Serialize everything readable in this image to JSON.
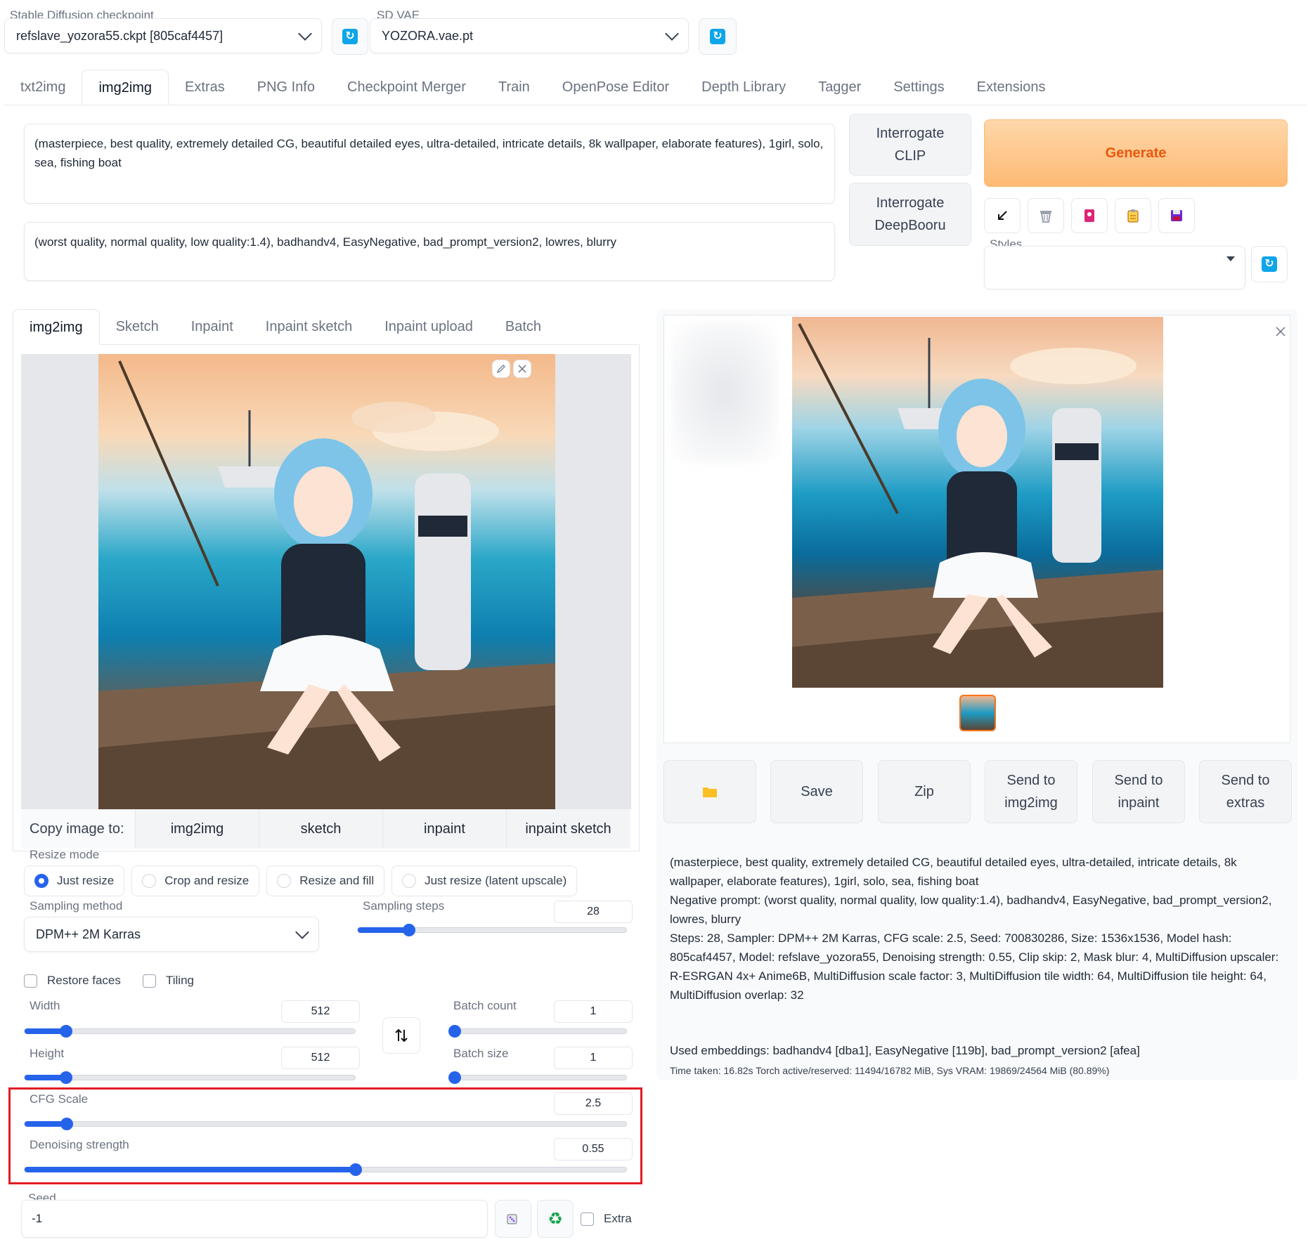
{
  "top": {
    "checkpoint_label": "Stable Diffusion checkpoint",
    "checkpoint_value": "refslave_yozora55.ckpt [805caf4457]",
    "vae_label": "SD VAE",
    "vae_value": "YOZORA.vae.pt"
  },
  "main_tabs": [
    "txt2img",
    "img2img",
    "Extras",
    "PNG Info",
    "Checkpoint Merger",
    "Train",
    "OpenPose Editor",
    "Depth Library",
    "Tagger",
    "Settings",
    "Extensions"
  ],
  "prompt": {
    "positive": "(masterpiece, best quality, extremely detailed CG, beautiful detailed eyes, ultra-detailed, intricate details, 8k wallpaper, elaborate features), 1girl, solo, sea, fishing boat",
    "negative": "(worst quality, normal quality, low quality:1.4), badhandv4, EasyNegative, bad_prompt_version2, lowres, blurry"
  },
  "interrogate": {
    "clip_line1": "Interrogate",
    "clip_line2": "CLIP",
    "deepbooru_line1": "Interrogate",
    "deepbooru_line2": "DeepBooru"
  },
  "generate_label": "Generate",
  "styles_label": "Styles",
  "sub_tabs": [
    "img2img",
    "Sketch",
    "Inpaint",
    "Inpaint sketch",
    "Inpaint upload",
    "Batch"
  ],
  "copy_image": {
    "label": "Copy image to:",
    "targets": [
      "img2img",
      "sketch",
      "inpaint",
      "inpaint sketch"
    ]
  },
  "resize_mode": {
    "label": "Resize mode",
    "options": [
      "Just resize",
      "Crop and resize",
      "Resize and fill",
      "Just resize (latent upscale)"
    ],
    "selected": "Just resize"
  },
  "sampling": {
    "method_label": "Sampling method",
    "method_value": "DPM++ 2M Karras",
    "steps_label": "Sampling steps",
    "steps_value": "28"
  },
  "checkboxes": {
    "restore_faces": "Restore faces",
    "tiling": "Tiling"
  },
  "dims": {
    "width_label": "Width",
    "width_value": "512",
    "height_label": "Height",
    "height_value": "512",
    "batch_count_label": "Batch count",
    "batch_count_value": "1",
    "batch_size_label": "Batch size",
    "batch_size_value": "1"
  },
  "cfg": {
    "label": "CFG Scale",
    "value": "2.5",
    "denoise_label": "Denoising strength",
    "denoise_value": "0.55"
  },
  "seed": {
    "label": "Seed",
    "value": "-1",
    "extra_label": "Extra"
  },
  "output_buttons": {
    "save": "Save",
    "zip": "Zip",
    "send_img2img_1": "Send to",
    "send_img2img_2": "img2img",
    "send_inpaint_1": "Send to",
    "send_inpaint_2": "inpaint",
    "send_extras_1": "Send to",
    "send_extras_2": "extras"
  },
  "info": {
    "prompt": "(masterpiece, best quality, extremely detailed CG, beautiful detailed eyes, ultra-detailed, intricate details, 8k wallpaper, elaborate features), 1girl, solo, sea, fishing boat",
    "negative": "Negative prompt: (worst quality, normal quality, low quality:1.4), badhandv4, EasyNegative, bad_prompt_version2, lowres, blurry",
    "params": "Steps: 28, Sampler: DPM++ 2M Karras, CFG scale: 2.5, Seed: 700830286, Size: 1536x1536, Model hash: 805caf4457, Model: refslave_yozora55, Denoising strength: 0.55, Clip skip: 2, Mask blur: 4, MultiDiffusion upscaler: R-ESRGAN 4x+ Anime6B, MultiDiffusion scale factor: 3, MultiDiffusion tile width: 64, MultiDiffusion tile height: 64, MultiDiffusion overlap: 32",
    "embeddings": "Used embeddings: badhandv4 [dba1], EasyNegative [119b], bad_prompt_version2 [afea]",
    "time": "Time taken: 16.82s  Torch active/reserved: 11494/16782 MiB, Sys VRAM: 19869/24564 MiB (80.89%)"
  },
  "sliders": {
    "sampling_steps": 0.19,
    "width": 0.125,
    "height": 0.125,
    "batch_count": 0.0,
    "batch_size": 0.0,
    "cfg_scale": 0.07,
    "denoising": 0.55
  },
  "colors": {
    "accent": "#2563eb",
    "generate": "#f97316",
    "highlight": "#e11d24"
  }
}
